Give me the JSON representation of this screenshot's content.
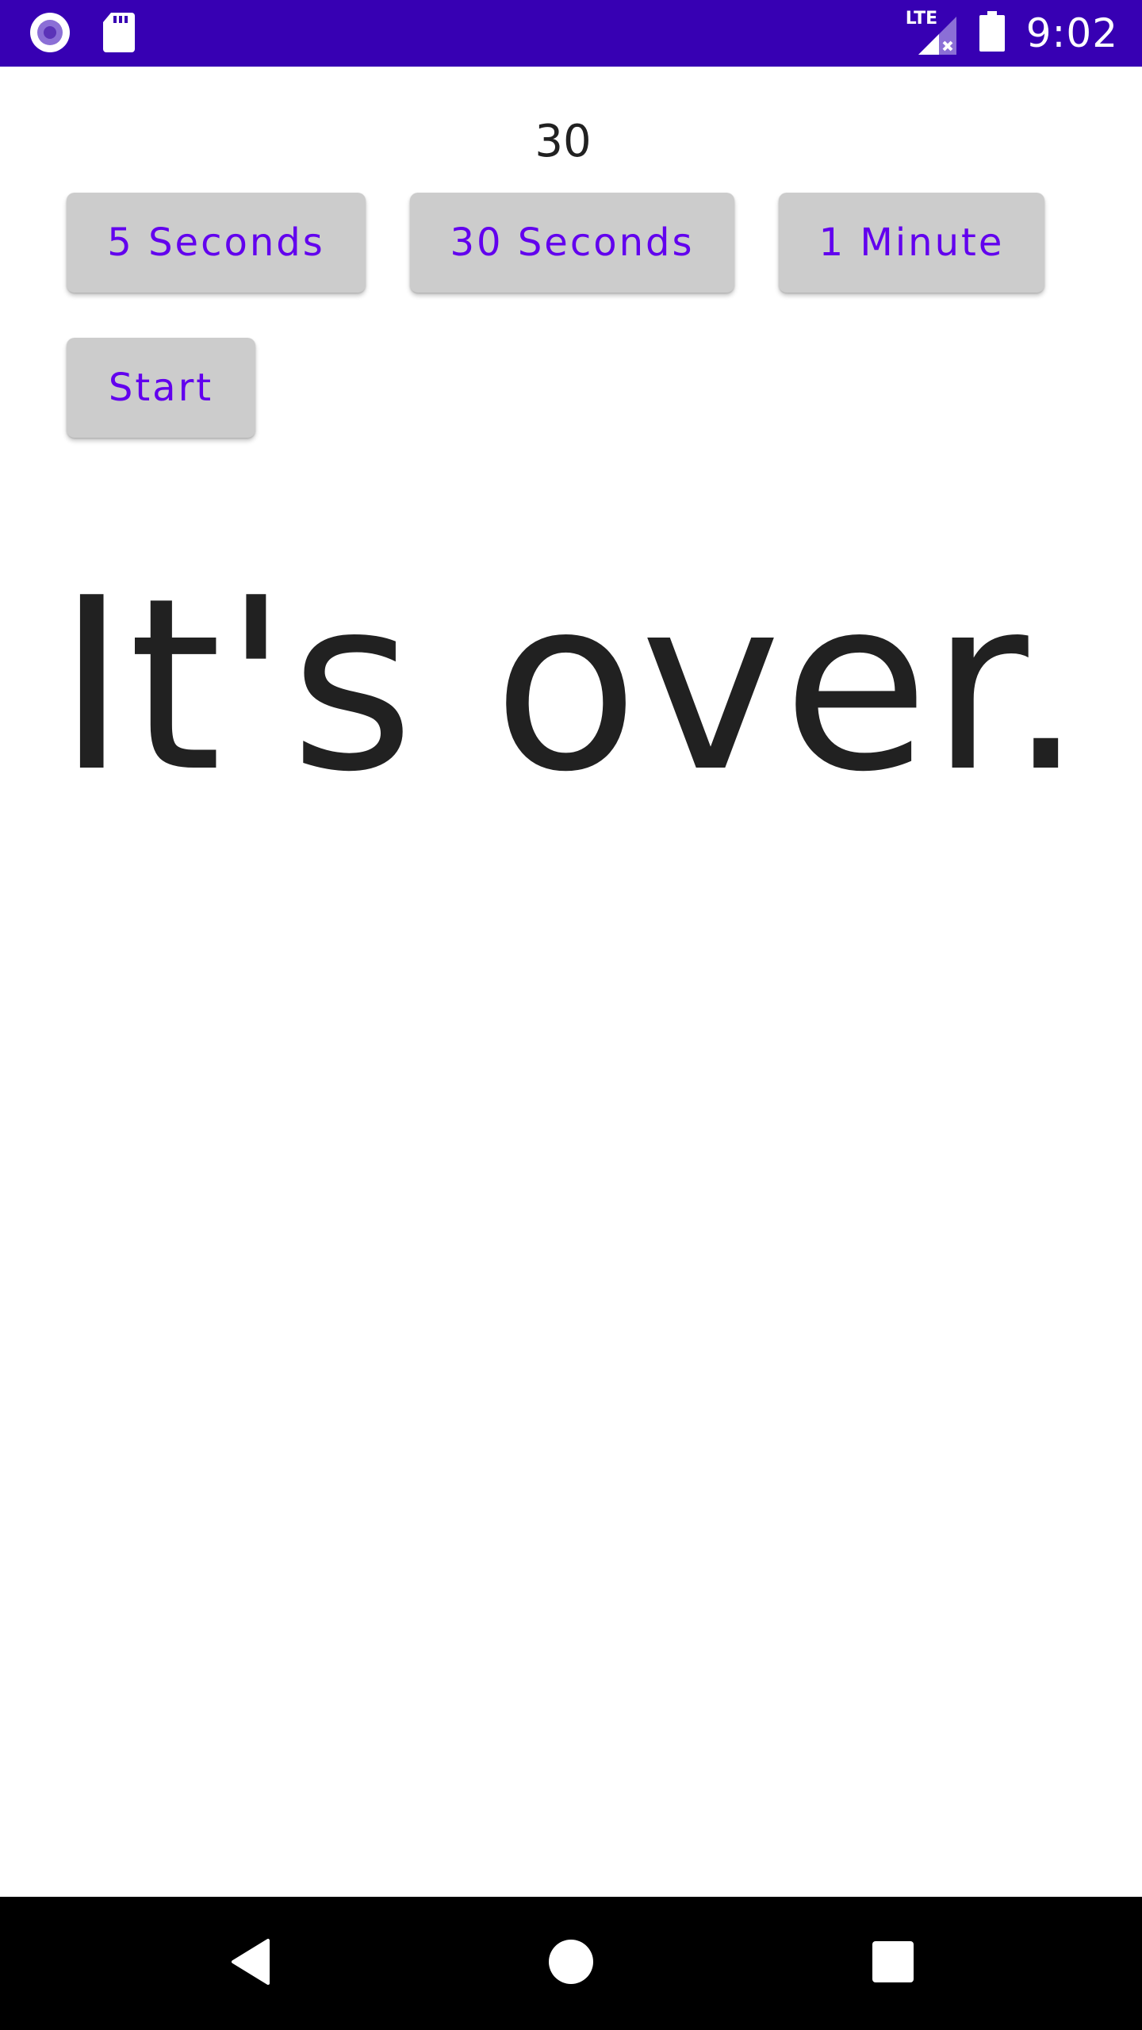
{
  "status_bar": {
    "time": "9:02",
    "network_label": "LTE",
    "left_icons": [
      "record-icon",
      "sd-card-icon"
    ],
    "right_icons": [
      "lte-signal-icon",
      "battery-icon"
    ],
    "background_color": "#3700b3"
  },
  "timer": {
    "counter_value": "30"
  },
  "buttons": {
    "five_seconds": "5 Seconds",
    "thirty_seconds": "30 Seconds",
    "one_minute": "1 Minute",
    "start": "Start",
    "text_color": "#6200ee",
    "background_color": "#cccccc"
  },
  "message": {
    "text": "It's over."
  },
  "nav_bar": {
    "icons": [
      "back-icon",
      "home-icon",
      "recents-icon"
    ]
  }
}
